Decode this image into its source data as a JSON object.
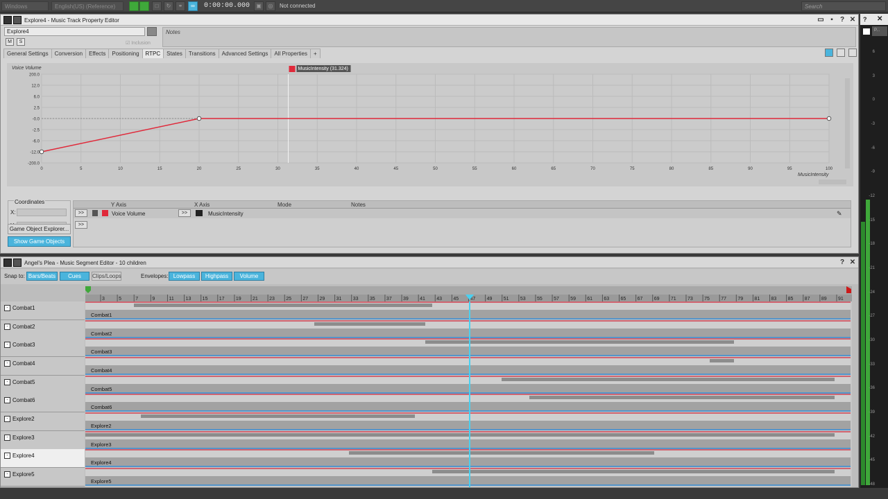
{
  "topbar": {
    "platform": "Windows",
    "language": "English(US) (Reference)",
    "timecode": "0:00:00.000",
    "connection": "Not connected",
    "search_placeholder": "Search"
  },
  "property_editor": {
    "title": "Explore4 - Music Track Property Editor",
    "object_name": "Explore4",
    "notes_placeholder": "Notes",
    "mute_label": "M",
    "solo_label": "S",
    "inclusion_label": "Inclusion",
    "tabs": [
      "General Settings",
      "Conversion",
      "Effects",
      "Positioning",
      "RTPC",
      "States",
      "Transitions",
      "Advanced Settings",
      "All Properties",
      "+"
    ],
    "active_tab": "RTPC",
    "graph": {
      "y_title": "Voice Volume",
      "x_title": "MusicIntensity",
      "marker_label": "MusicIntensity (31.324)",
      "y_ticks": [
        "200.0",
        "12.0",
        "6.0",
        "2.5",
        "-0.0",
        "-2.5",
        "-6.0",
        "-12.0",
        "-200.0"
      ],
      "x_ticks": [
        "0",
        "5",
        "10",
        "15",
        "20",
        "25",
        "30",
        "35",
        "40",
        "45",
        "50",
        "55",
        "60",
        "65",
        "70",
        "75",
        "80",
        "85",
        "90",
        "95",
        "100"
      ],
      "points": [
        {
          "x": 0,
          "y": -12.0
        },
        {
          "x": 20,
          "y": 0.0
        },
        {
          "x": 100,
          "y": 0.0
        }
      ],
      "marker_x": 31.324
    },
    "coordinates": {
      "label": "Coordinates",
      "x_label": "X:",
      "y_label": "Y:"
    },
    "game_object_explorer": "Game Object Explorer...",
    "show_game_objects": "Show Game Objects",
    "rtpc_table": {
      "headers": [
        "Y Axis",
        "X Axis",
        "Mode",
        "Notes"
      ],
      "row": {
        "y_axis": "Voice Volume",
        "x_axis": "MusicIntensity",
        "arrow": ">>"
      }
    }
  },
  "segment_editor": {
    "title": "Angel's Plea - Music Segment Editor - 10 children",
    "snap_to_label": "Snap to:",
    "snap_buttons": [
      "Bars/Beats",
      "Cues",
      "Clips/Loops"
    ],
    "envelopes_label": "Envelopes:",
    "envelope_buttons": [
      "Lowpass",
      "Highpass",
      "Volume"
    ],
    "bar_numbers": [
      "3",
      "5",
      "7",
      "9",
      "11",
      "13",
      "15",
      "17",
      "19",
      "21",
      "23",
      "25",
      "27",
      "29",
      "31",
      "33",
      "35",
      "37",
      "39",
      "41",
      "43",
      "45",
      "47",
      "49",
      "51",
      "53",
      "55",
      "57",
      "59",
      "61",
      "63",
      "65",
      "67",
      "69",
      "71",
      "73",
      "75",
      "77",
      "79",
      "81",
      "83",
      "85",
      "87",
      "89",
      "91"
    ],
    "tracks": [
      "Combat1",
      "Combat2",
      "Combat3",
      "Combat4",
      "Combat5",
      "Combat6",
      "Explore2",
      "Explore3",
      "Explore4",
      "Explore5"
    ],
    "clips": [
      "Combat1",
      "Combat2",
      "Combat3",
      "Combat4",
      "Combat5",
      "Combat6",
      "Explore2",
      "Explore3",
      "Explore4",
      "Explore5"
    ],
    "selected_track": "Explore4"
  },
  "meter": {
    "labels": [
      "6",
      "3",
      "0",
      "-3",
      "-6",
      "-9",
      "-12",
      "-15",
      "-18",
      "-21",
      "-24",
      "-27",
      "-30",
      "-33",
      "-36",
      "-39",
      "-42",
      "-45",
      "-48"
    ]
  },
  "colors": {
    "accent": "#4ab4dc",
    "curve": "#e0293a",
    "green": "#3fa83a"
  }
}
